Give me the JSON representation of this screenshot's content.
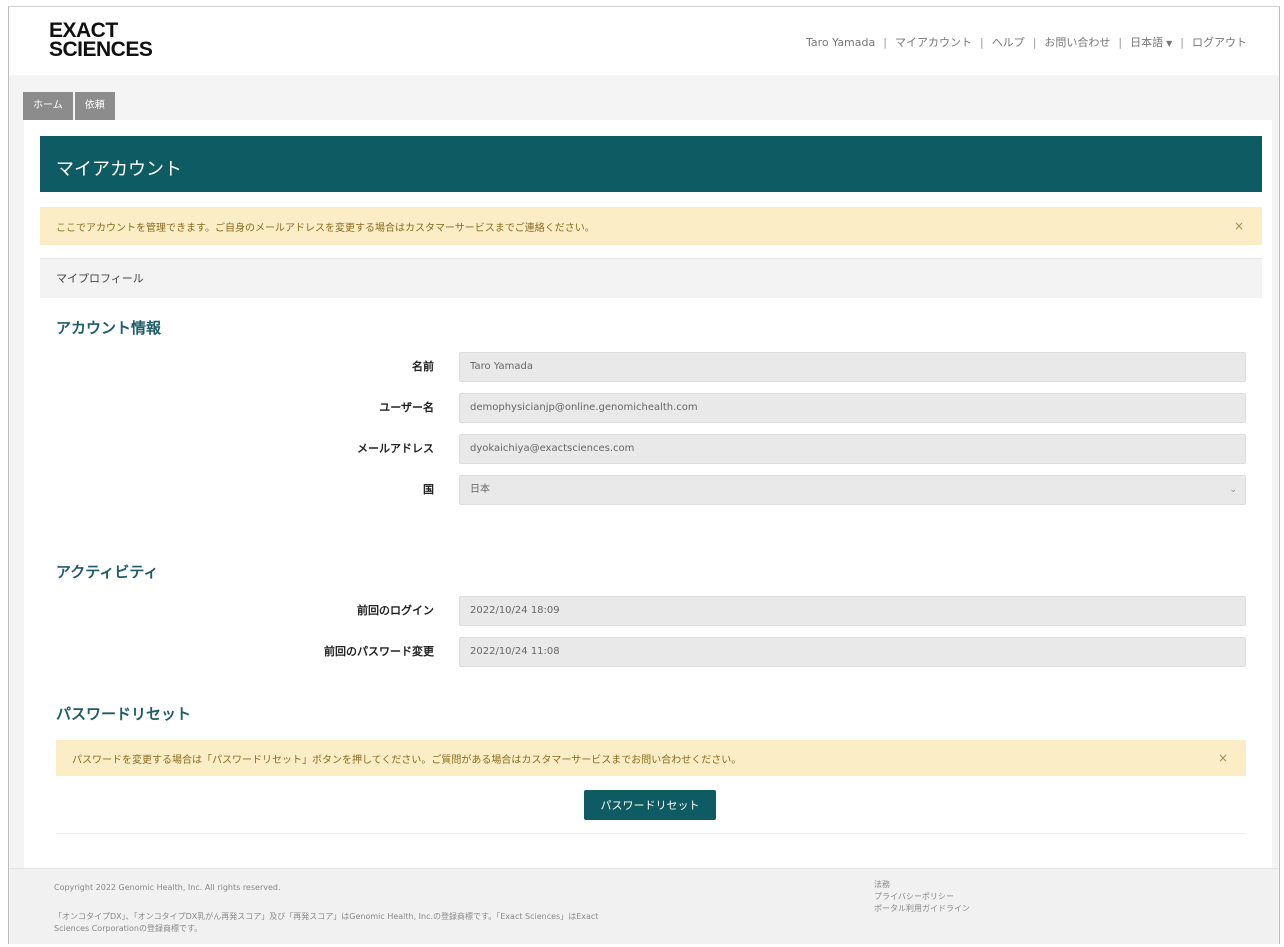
{
  "brand": {
    "line1": "EXACT",
    "line2": "SCIENCES"
  },
  "topnav": {
    "user": "Taro Yamada",
    "my_account": "マイアカウント",
    "help": "ヘルプ",
    "contact": "お問い合わせ",
    "language": "日本語",
    "logout": "ログアウト",
    "separator": "|"
  },
  "tabs": [
    {
      "label": "ホーム"
    },
    {
      "label": "依頼"
    }
  ],
  "page": {
    "title": "マイアカウント",
    "info_alert": "ここでアカウントを管理できます。ご自身のメールアドレスを変更する場合はカスタマーサービスまでご連絡ください。",
    "close_glyph": "×",
    "profile_bar": "マイプロフィール"
  },
  "account": {
    "heading": "アカウント情報",
    "name_label": "名前",
    "name_value": "Taro Yamada",
    "username_label": "ユーザー名",
    "username_value": "demophysicianjp@online.genomichealth.com",
    "email_label": "メールアドレス",
    "email_value": "dyokaichiya@exactsciences.com",
    "country_label": "国",
    "country_value": "日本"
  },
  "activity": {
    "heading": "アクティビティ",
    "last_login_label": "前回のログイン",
    "last_login_value": "2022/10/24 18:09",
    "last_pw_change_label": "前回のパスワード変更",
    "last_pw_change_value": "2022/10/24 11:08"
  },
  "password": {
    "heading": "パスワードリセット",
    "alert": "パスワードを変更する場合は「パスワードリセット」ボタンを押してください。ご質問がある場合はカスタマーサービスまでお問い合わせください。",
    "button": "パスワードリセット"
  },
  "footer": {
    "copyright": "Copyright 2022 Genomic Health, Inc. All rights reserved.",
    "trademark_line1": "「オンコタイプDX」、「オンコタイプDX乳がん再発スコア」及び「再発スコア」はGenomic Health, Inc.の登録商標です。「Exact Sciences」はExact",
    "trademark_line2": "Sciences Corporationの登録商標です。",
    "link_legal": "法務",
    "link_privacy": "プライバシーポリシー",
    "link_portal_guide": "ポータル利用ガイドライン"
  },
  "colors": {
    "accent": "#0f5b63",
    "alert_bg": "#fbeec7",
    "tab_bg": "#8c8c8c"
  }
}
